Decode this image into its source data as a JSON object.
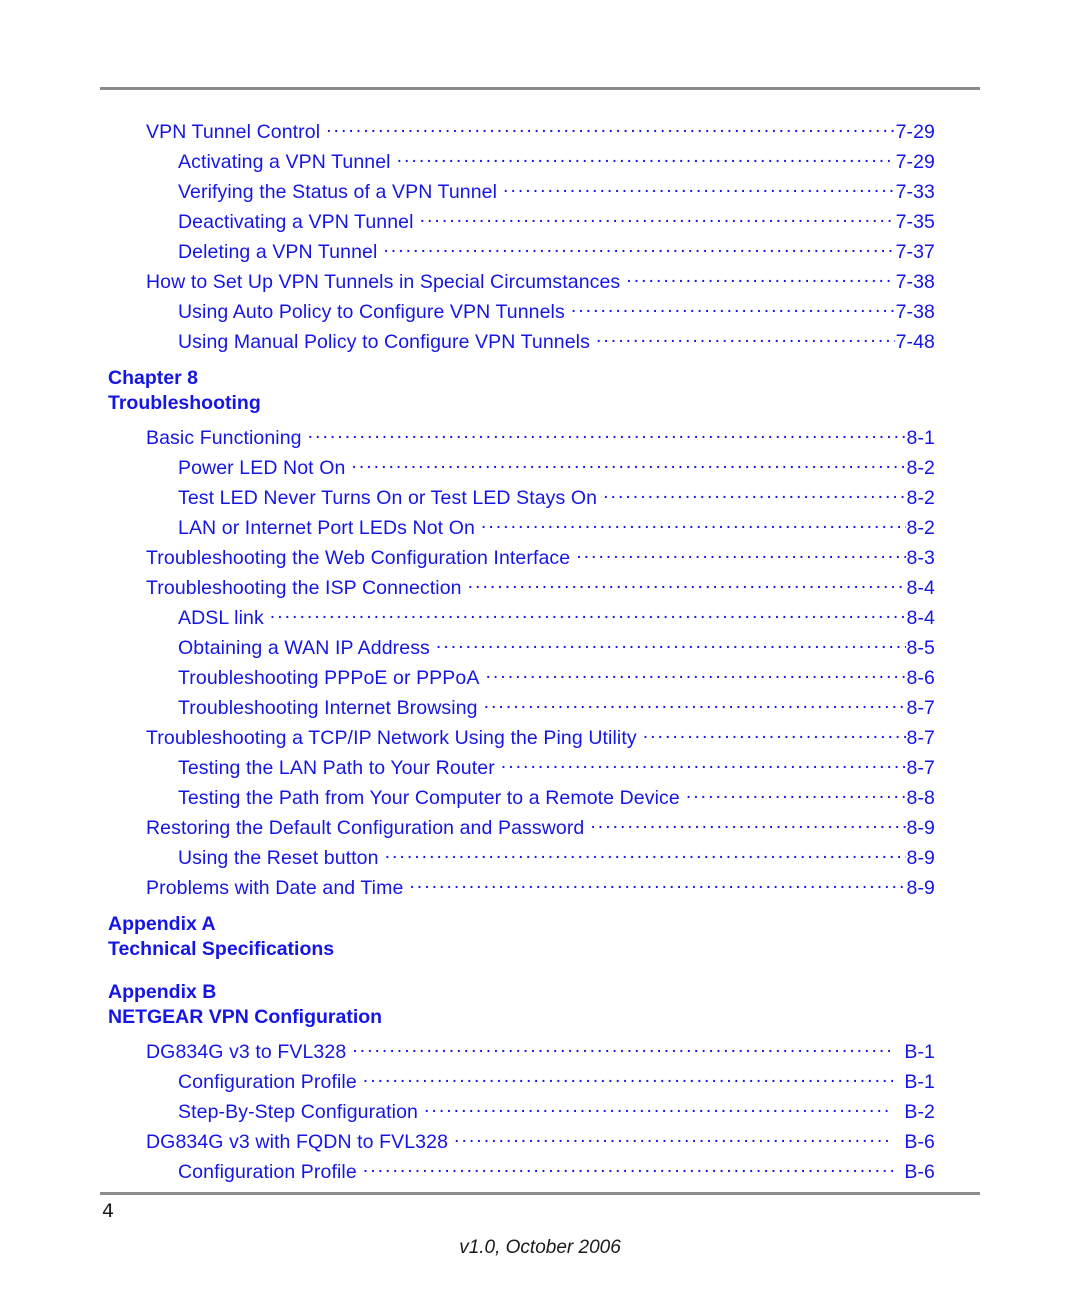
{
  "document": {
    "type": "table-of-contents",
    "accent_color": "#1616e4",
    "rule_color": "#8c8c8c",
    "background_color": "#ffffff"
  },
  "toc": {
    "groups": [
      {
        "kind": "entries",
        "entries": [
          {
            "level": 1,
            "title": "VPN Tunnel Control",
            "page": "7-29"
          },
          {
            "level": 2,
            "title": "Activating a VPN Tunnel",
            "page": "7-29"
          },
          {
            "level": 2,
            "title": "Verifying the Status of a VPN Tunnel",
            "page": "7-33"
          },
          {
            "level": 2,
            "title": "Deactivating a VPN Tunnel",
            "page": "7-35"
          },
          {
            "level": 2,
            "title": "Deleting a VPN Tunnel",
            "page": "7-37"
          },
          {
            "level": 1,
            "title": "How to Set Up VPN Tunnels in Special Circumstances",
            "page": "7-38"
          },
          {
            "level": 2,
            "title": "Using Auto Policy to Configure VPN Tunnels",
            "page": "7-38"
          },
          {
            "level": 2,
            "title": "Using Manual Policy to Configure VPN Tunnels",
            "page": "7-48"
          }
        ]
      },
      {
        "kind": "heading",
        "line1": "Chapter 8",
        "line2": "Troubleshooting"
      },
      {
        "kind": "entries",
        "entries": [
          {
            "level": 1,
            "title": "Basic Functioning",
            "page": "8-1"
          },
          {
            "level": 2,
            "title": "Power LED Not On",
            "page": "8-2"
          },
          {
            "level": 2,
            "title": "Test LED Never Turns On or Test LED Stays On",
            "page": "8-2"
          },
          {
            "level": 2,
            "title": "LAN or Internet Port LEDs Not On",
            "page": "8-2"
          },
          {
            "level": 1,
            "title": "Troubleshooting the Web Configuration Interface",
            "page": "8-3"
          },
          {
            "level": 1,
            "title": "Troubleshooting the ISP Connection",
            "page": "8-4"
          },
          {
            "level": 2,
            "title": "ADSL link",
            "page": "8-4"
          },
          {
            "level": 2,
            "title": "Obtaining a WAN IP Address",
            "page": "8-5"
          },
          {
            "level": 2,
            "title": "Troubleshooting PPPoE or PPPoA",
            "page": "8-6"
          },
          {
            "level": 2,
            "title": "Troubleshooting Internet Browsing",
            "page": "8-7"
          },
          {
            "level": 1,
            "title": "Troubleshooting a TCP/IP Network Using the Ping Utility",
            "page": "8-7"
          },
          {
            "level": 2,
            "title": "Testing the LAN Path to Your Router",
            "page": "8-7"
          },
          {
            "level": 2,
            "title": "Testing the Path from Your Computer to a Remote Device",
            "page": "8-8"
          },
          {
            "level": 1,
            "title": "Restoring the Default Configuration and Password",
            "page": "8-9"
          },
          {
            "level": 2,
            "title": "Using the Reset button",
            "page": "8-9"
          },
          {
            "level": 1,
            "title": "Problems with Date and Time",
            "page": "8-9"
          }
        ]
      },
      {
        "kind": "heading",
        "line1": "Appendix A",
        "line2": "Technical Specifications"
      },
      {
        "kind": "heading",
        "line1": "Appendix B",
        "line2": "NETGEAR VPN Configuration"
      },
      {
        "kind": "entries",
        "gap_before_pageno": true,
        "entries": [
          {
            "level": 1,
            "title": "DG834G v3 to FVL328",
            "page": "B-1"
          },
          {
            "level": 2,
            "title": "Configuration Profile",
            "page": "B-1"
          },
          {
            "level": 2,
            "title": "Step-By-Step Configuration",
            "page": "B-2"
          },
          {
            "level": 1,
            "title": "DG834G v3 with FQDN to FVL328",
            "page": "B-6"
          },
          {
            "level": 2,
            "title": "Configuration Profile",
            "page": "B-6"
          }
        ]
      }
    ]
  },
  "footer": {
    "page_number": "4",
    "version": "v1.0, October 2006"
  }
}
